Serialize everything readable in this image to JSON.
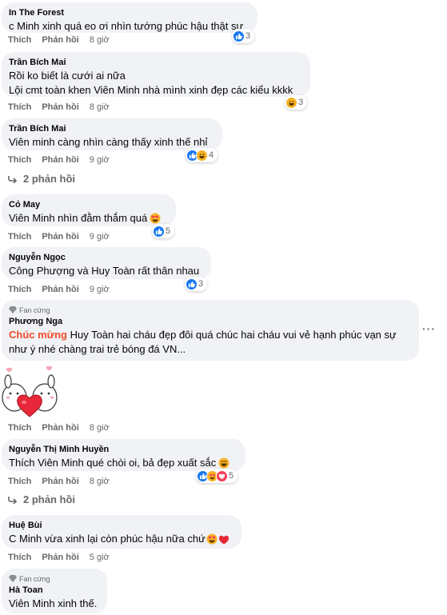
{
  "labels": {
    "like": "Thích",
    "reply": "Phản hồi",
    "fan_badge": "Fan cứng"
  },
  "comments": [
    {
      "author": "In The Forest",
      "lines": [
        "c Minh xinh quá eo ơi nhìn tướng phúc hậu thật sự"
      ],
      "time": "8 giờ",
      "reactions": {
        "icons": [
          "like"
        ],
        "count": "3"
      }
    },
    {
      "author": "Trần Bích Mai",
      "lines": [
        "Rồi ko biết là cưới ai nữa",
        "Lội cmt toàn khen Viên Minh nhà mình xinh đẹp các kiểu kkkk"
      ],
      "time": "8 giờ",
      "reactions": {
        "icons": [
          "haha"
        ],
        "count": "3"
      }
    },
    {
      "author": "Trần Bích Mai",
      "lines": [
        "Viên minh càng nhìn càng thấy xinh thế nhỉ"
      ],
      "time": "9 giờ",
      "reactions": {
        "icons": [
          "like",
          "haha"
        ],
        "count": "4"
      },
      "replies": "2 phản hồi"
    },
    {
      "author": "Cỏ May",
      "lines": [
        "Viên Minh nhìn đằm thắm quá"
      ],
      "time": "9 giờ",
      "reactions": {
        "icons": [
          "like"
        ],
        "count": "5"
      }
    },
    {
      "author": "Nguyễn Ngọc",
      "lines": [
        "Công Phượng và Huy Toàn rất thân nhau"
      ],
      "time": "9 giờ",
      "reactions": {
        "icons": [
          "like"
        ],
        "count": "3"
      }
    },
    {
      "author": "Phương Nga",
      "badge": "Fan cứng",
      "highlight": "Chúc mừng",
      "lines": [
        " Huy Toàn hai cháu đẹp đôi quá chúc hai cháu vui vẻ hạnh phúc vạn sự",
        "như ý nhé chàng trai trẻ bóng đá VN..."
      ],
      "time": "8 giờ"
    },
    {
      "author": "Nguyễn Thị Minh Huyền",
      "lines": [
        "Thích Viên Minh qué chòi oi, bả đẹp xuất sắc"
      ],
      "time": "8 giờ",
      "reactions": {
        "icons": [
          "like",
          "love-eyes",
          "heart"
        ],
        "count": "5"
      },
      "replies": "2 phản hồi"
    },
    {
      "author": "Huệ Bùi",
      "lines": [
        "C Minh vừa xinh lại còn phúc hậu nữa chứ"
      ],
      "time": "5 giờ"
    },
    {
      "author": "Hà Toan",
      "badge": "Fan cứng",
      "lines": [
        "Viên Minh xinh thế."
      ]
    }
  ],
  "colors": {
    "bubble": "#f0f2f5",
    "meta": "#65676b",
    "highlight": "#ee4b2b",
    "like": "#1877f2",
    "love": "#f33e58",
    "emoji": "#f7b125"
  }
}
